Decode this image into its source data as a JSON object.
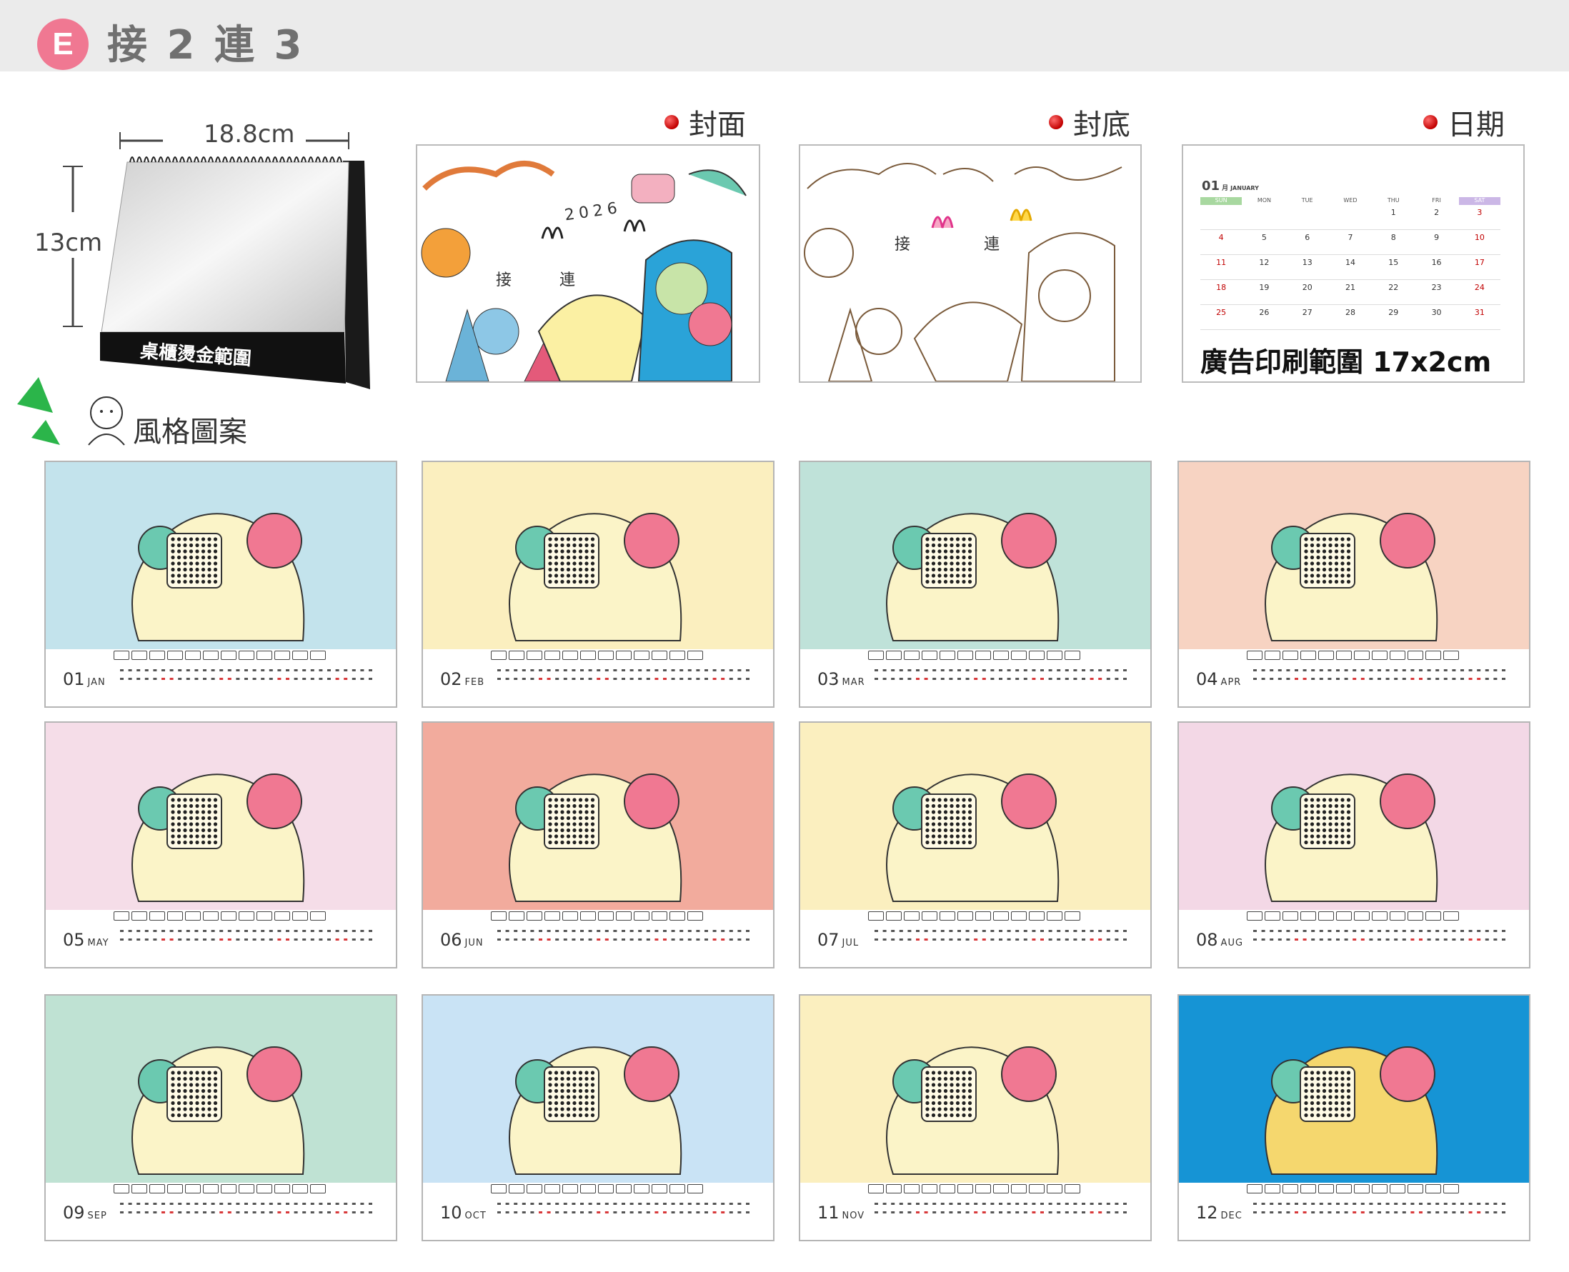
{
  "header": {
    "badge": "E",
    "title": "接 2 連 3"
  },
  "product": {
    "width_label": "18.8cm",
    "height_label": "13cm",
    "plate_label": "桌櫃燙金範圍"
  },
  "sections": {
    "cover": "封面",
    "back": "封底",
    "date": "日期",
    "style": "風格圖案"
  },
  "cover_art": {
    "year": "2026",
    "text": "接 連"
  },
  "back_art": {
    "text": "接 連"
  },
  "date_preview": {
    "month_num": "01",
    "month_cn": "月",
    "month_en": "JANUARY",
    "weekdays": [
      "SUN",
      "MON",
      "TUE",
      "WED",
      "THU",
      "FRI",
      "SAT"
    ],
    "weeks": [
      [
        "",
        "",
        "",
        "",
        "1",
        "2",
        "3"
      ],
      [
        "4",
        "5",
        "6",
        "7",
        "8",
        "9",
        "10"
      ],
      [
        "11",
        "12",
        "13",
        "14",
        "15",
        "16",
        "17"
      ],
      [
        "18",
        "19",
        "20",
        "21",
        "22",
        "23",
        "24"
      ],
      [
        "25",
        "26",
        "27",
        "28",
        "29",
        "30",
        "31"
      ]
    ],
    "ad_caption": "廣告印刷範圍 17x2cm"
  },
  "months": [
    {
      "num": "01",
      "abbr": "JAN",
      "bg": "#c3e3ec"
    },
    {
      "num": "02",
      "abbr": "FEB",
      "bg": "#fbefbf"
    },
    {
      "num": "03",
      "abbr": "MAR",
      "bg": "#bfe2d9"
    },
    {
      "num": "04",
      "abbr": "APR",
      "bg": "#f7d3c2"
    },
    {
      "num": "05",
      "abbr": "MAY",
      "bg": "#f5dde8"
    },
    {
      "num": "06",
      "abbr": "JUN",
      "bg": "#f2ab9d"
    },
    {
      "num": "07",
      "abbr": "JUL",
      "bg": "#fbefbf"
    },
    {
      "num": "08",
      "abbr": "AUG",
      "bg": "#f3d8e6"
    },
    {
      "num": "09",
      "abbr": "SEP",
      "bg": "#bfe2d3"
    },
    {
      "num": "10",
      "abbr": "OCT",
      "bg": "#c9e3f5"
    },
    {
      "num": "11",
      "abbr": "NOV",
      "bg": "#fbefbf"
    },
    {
      "num": "12",
      "abbr": "DEC",
      "bg": "#1694d5"
    }
  ],
  "colors": {
    "badge": "#f07892",
    "header_band": "#ebebeb",
    "accent_red": "#c10000",
    "sun_tab": "#a8d8a0",
    "sat_tab": "#cbb7e6"
  }
}
